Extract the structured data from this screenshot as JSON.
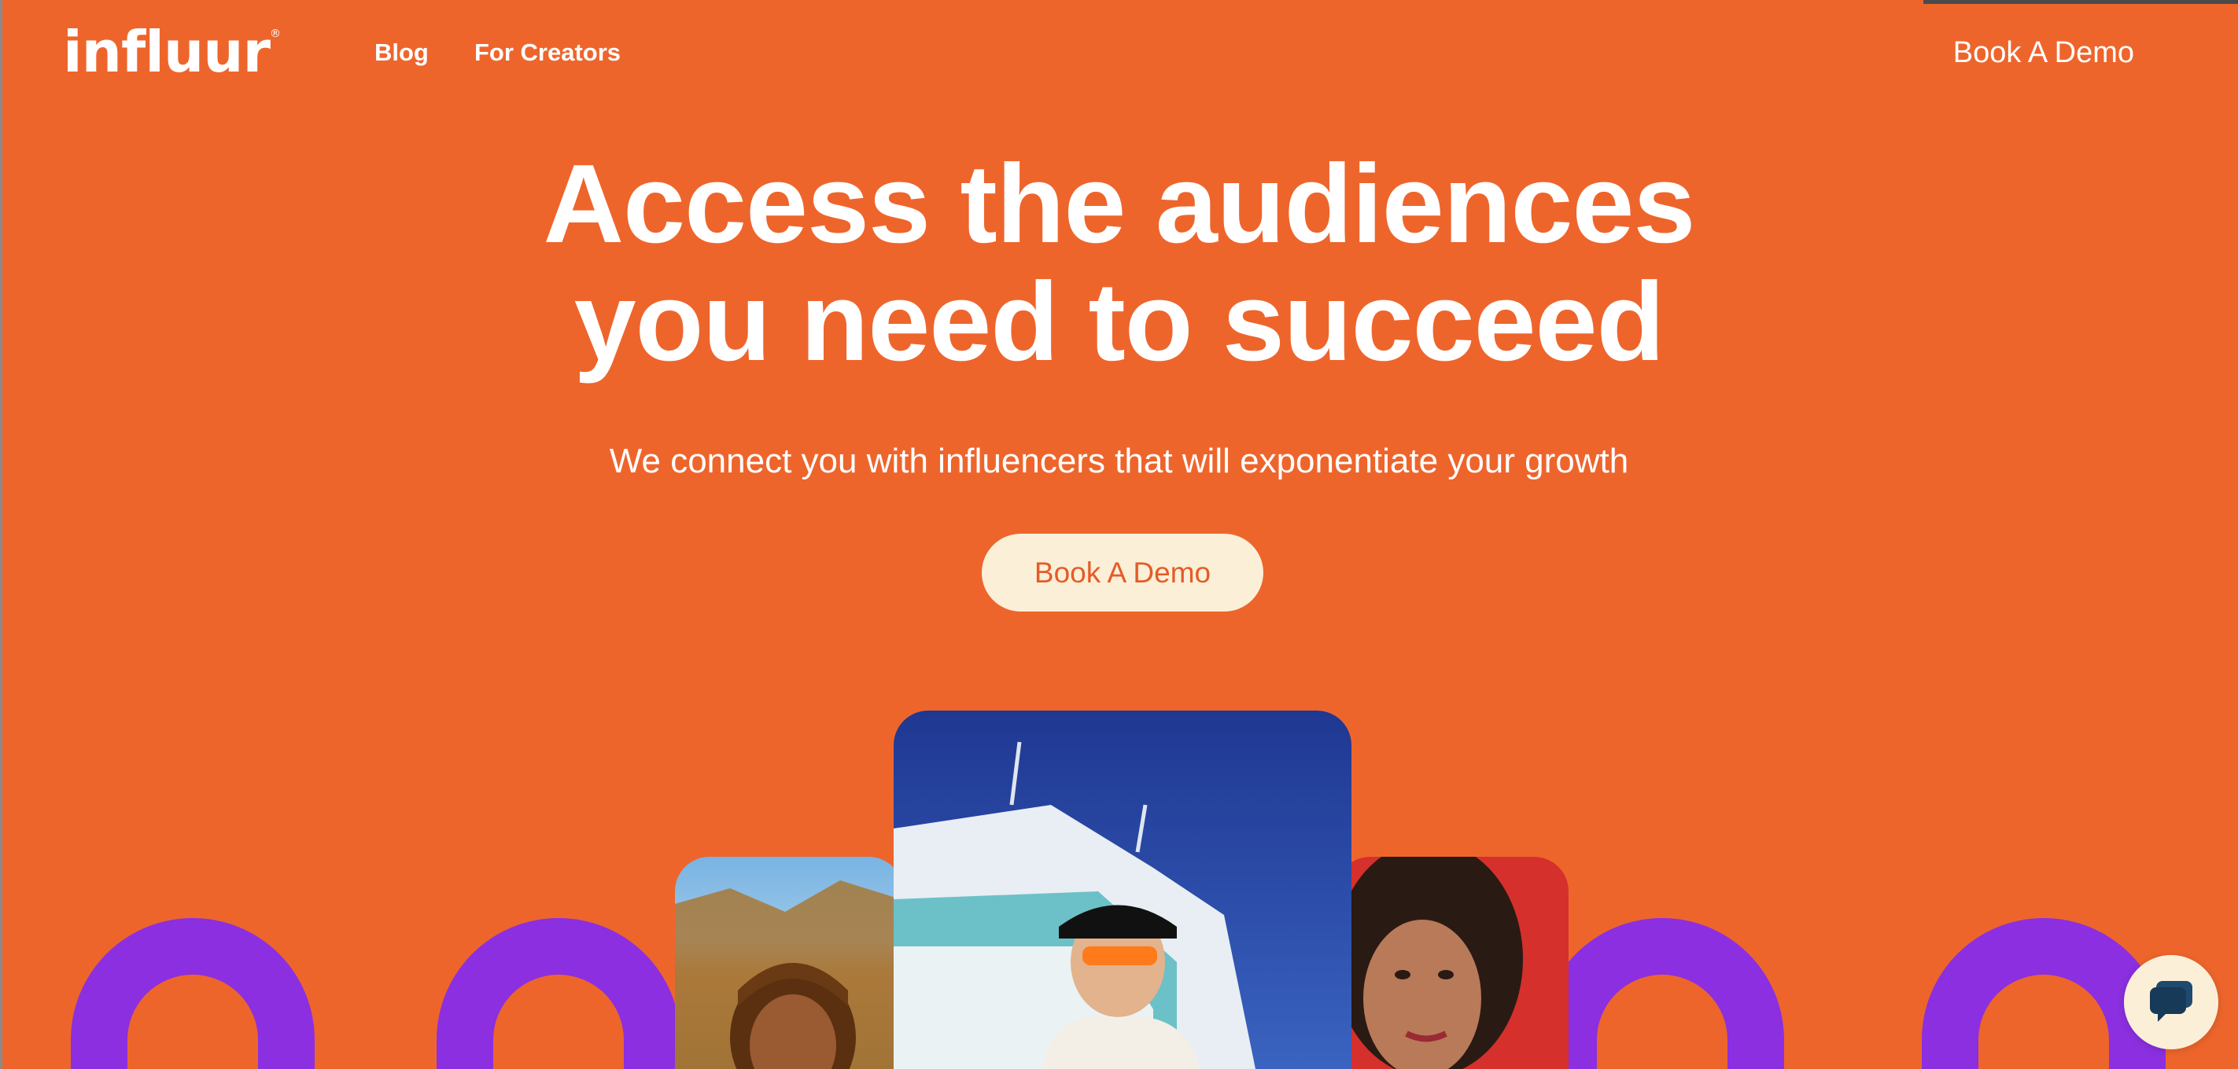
{
  "brand": {
    "name": "influur",
    "registered_mark": "®"
  },
  "nav": {
    "blog_label": "Blog",
    "creators_label": "For Creators",
    "demo_label": "Book A Demo"
  },
  "hero": {
    "headline_line1": "Access the audiences",
    "headline_line2": "you need to succeed",
    "subtitle": "We connect you with influencers that will exponentiate your growth",
    "cta_label": "Book A Demo"
  },
  "gallery": {
    "cards": [
      {
        "name": "creator-photo-left"
      },
      {
        "name": "creator-photo-center"
      },
      {
        "name": "creator-photo-right"
      }
    ]
  },
  "chat": {
    "icon": "chat-bubble-icon"
  },
  "colors": {
    "background": "#ee652c",
    "cta_background": "#fcefd8",
    "cta_text": "#e45c27",
    "arch_purple": "#8b2fe0"
  }
}
